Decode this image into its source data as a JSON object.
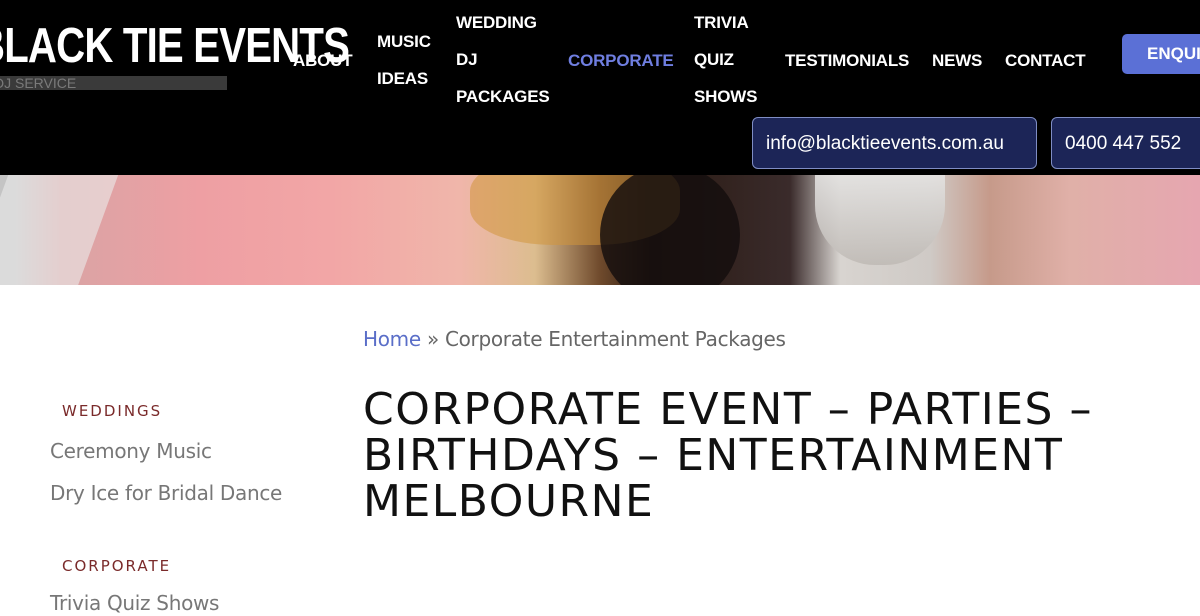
{
  "header": {
    "logo_title": "BLACK TIE EVENTS",
    "logo_subtitle": "DJ SERVICE",
    "nav": {
      "about": [
        "ABOUT"
      ],
      "music_ideas": [
        "MUSIC",
        "IDEAS"
      ],
      "wedding_dj": [
        "WEDDING",
        "DJ",
        "PACKAGES"
      ],
      "corporate": [
        "CORPORATE"
      ],
      "trivia": [
        "TRIVIA",
        "QUIZ",
        "SHOWS"
      ],
      "testimonials": [
        "TESTIMONIALS"
      ],
      "news": [
        "NEWS"
      ],
      "contact": [
        "CONTACT"
      ]
    },
    "enquire_label": "ENQUIRE",
    "email": "info@blacktieevents.com.au",
    "phone": "0400 447 552"
  },
  "breadcrumb": {
    "home": "Home",
    "separator": "»",
    "current": "Corporate Entertainment Packages"
  },
  "page_title": "CORPORATE EVENT – PARTIES – BIRTHDAYS – ENTERTAINMENT MELBOURNE",
  "sidebar": {
    "weddings_heading": "WEDDINGS",
    "weddings_items": [
      "Ceremony Music",
      "Dry Ice for Bridal Dance"
    ],
    "corporate_heading": "CORPORATE",
    "corporate_items": [
      "Trivia Quiz Shows"
    ]
  },
  "colors": {
    "accent_blue": "#5b70d6",
    "active_nav": "#6f7ee0",
    "contact_button_bg": "#1c2557",
    "sidebar_heading": "#7a2a2a"
  }
}
